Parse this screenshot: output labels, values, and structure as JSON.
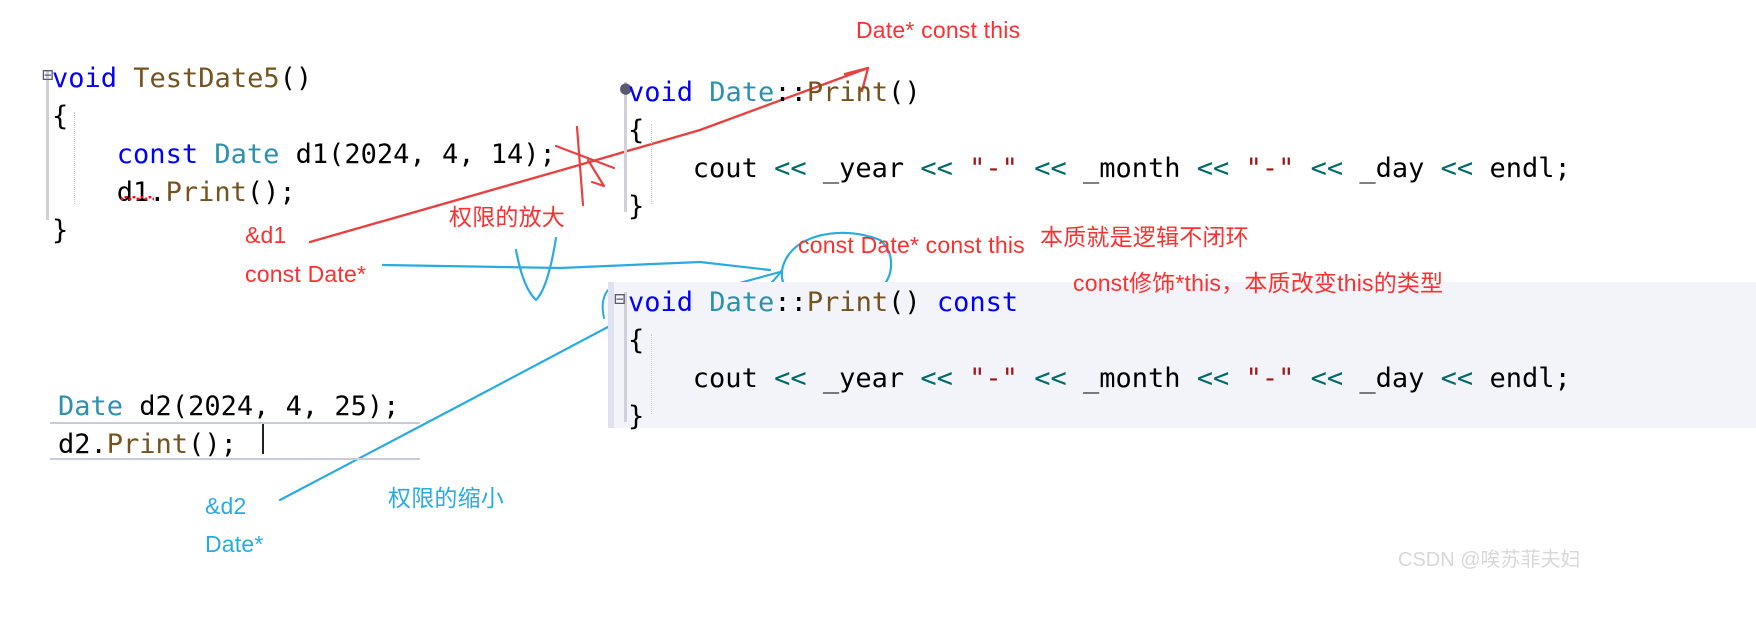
{
  "editor": {
    "upper_left_block": {
      "name": "TestDate5 function",
      "lines": [
        {
          "indent": 0,
          "tokens": [
            {
              "t": "void ",
              "c": "kw"
            },
            {
              "t": "TestDate5",
              "c": "fn"
            },
            {
              "t": "()",
              "c": "ident"
            }
          ]
        },
        {
          "indent": 0,
          "tokens": [
            {
              "t": "{",
              "c": "ident"
            }
          ]
        },
        {
          "indent": 1,
          "tokens": [
            {
              "t": "const ",
              "c": "kw"
            },
            {
              "t": "Date",
              "c": "type"
            },
            {
              "t": " d1(",
              "c": "ident"
            },
            {
              "t": "2024",
              "c": "num"
            },
            {
              "t": ", ",
              "c": "ident"
            },
            {
              "t": "4",
              "c": "num"
            },
            {
              "t": ", ",
              "c": "ident"
            },
            {
              "t": "14",
              "c": "num"
            },
            {
              "t": ");",
              "c": "ident"
            }
          ]
        },
        {
          "indent": 1,
          "tokens": [
            {
              "t": "d1.",
              "c": "ident"
            },
            {
              "t": "Print",
              "c": "fn"
            },
            {
              "t": "();",
              "c": "ident"
            }
          ]
        },
        {
          "indent": 0,
          "tokens": [
            {
              "t": "}",
              "c": "ident"
            }
          ]
        }
      ]
    },
    "upper_right_block": {
      "name": "Date::Print non-const",
      "lines": [
        {
          "indent": 0,
          "tokens": [
            {
              "t": "void ",
              "c": "kw"
            },
            {
              "t": "Date",
              "c": "type"
            },
            {
              "t": "::",
              "c": "ident"
            },
            {
              "t": "Print",
              "c": "fn"
            },
            {
              "t": "()",
              "c": "ident"
            }
          ]
        },
        {
          "indent": 0,
          "tokens": [
            {
              "t": "{",
              "c": "ident"
            }
          ]
        },
        {
          "indent": 1,
          "tokens": [
            {
              "t": "cout ",
              "c": "ident"
            },
            {
              "t": "<<",
              "c": "op"
            },
            {
              "t": " _year ",
              "c": "ident"
            },
            {
              "t": "<<",
              "c": "op"
            },
            {
              "t": " ",
              "c": "ident"
            },
            {
              "t": "\"-\"",
              "c": "str"
            },
            {
              "t": " ",
              "c": "ident"
            },
            {
              "t": "<<",
              "c": "op"
            },
            {
              "t": " _month ",
              "c": "ident"
            },
            {
              "t": "<<",
              "c": "op"
            },
            {
              "t": " ",
              "c": "ident"
            },
            {
              "t": "\"-\"",
              "c": "str"
            },
            {
              "t": " ",
              "c": "ident"
            },
            {
              "t": "<<",
              "c": "op"
            },
            {
              "t": " _day ",
              "c": "ident"
            },
            {
              "t": "<<",
              "c": "op"
            },
            {
              "t": " endl;",
              "c": "ident"
            }
          ]
        },
        {
          "indent": 0,
          "tokens": [
            {
              "t": "}",
              "c": "ident"
            }
          ]
        }
      ]
    },
    "lower_right_block": {
      "name": "Date::Print const",
      "lines": [
        {
          "indent": 0,
          "tokens": [
            {
              "t": "void ",
              "c": "kw"
            },
            {
              "t": "Date",
              "c": "type"
            },
            {
              "t": "::",
              "c": "ident"
            },
            {
              "t": "Print",
              "c": "fn"
            },
            {
              "t": "() ",
              "c": "ident"
            },
            {
              "t": "const",
              "c": "kw"
            }
          ]
        },
        {
          "indent": 0,
          "tokens": [
            {
              "t": "{",
              "c": "ident"
            }
          ]
        },
        {
          "indent": 1,
          "tokens": [
            {
              "t": "cout ",
              "c": "ident"
            },
            {
              "t": "<<",
              "c": "op"
            },
            {
              "t": " _year ",
              "c": "ident"
            },
            {
              "t": "<<",
              "c": "op"
            },
            {
              "t": " ",
              "c": "ident"
            },
            {
              "t": "\"-\"",
              "c": "str"
            },
            {
              "t": " ",
              "c": "ident"
            },
            {
              "t": "<<",
              "c": "op"
            },
            {
              "t": " _month ",
              "c": "ident"
            },
            {
              "t": "<<",
              "c": "op"
            },
            {
              "t": " ",
              "c": "ident"
            },
            {
              "t": "\"-\"",
              "c": "str"
            },
            {
              "t": " ",
              "c": "ident"
            },
            {
              "t": "<<",
              "c": "op"
            },
            {
              "t": " _day ",
              "c": "ident"
            },
            {
              "t": "<<",
              "c": "op"
            },
            {
              "t": " endl;",
              "c": "ident"
            }
          ]
        },
        {
          "indent": 0,
          "tokens": [
            {
              "t": "}",
              "c": "ident"
            }
          ]
        }
      ]
    },
    "bottom_left_block": {
      "name": "d2 snippet",
      "lines": [
        {
          "indent": 0,
          "tokens": [
            {
              "t": "Date",
              "c": "type"
            },
            {
              "t": " d2(",
              "c": "ident"
            },
            {
              "t": "2024",
              "c": "num"
            },
            {
              "t": ", ",
              "c": "ident"
            },
            {
              "t": "4",
              "c": "num"
            },
            {
              "t": ", ",
              "c": "ident"
            },
            {
              "t": "25",
              "c": "num"
            },
            {
              "t": ");",
              "c": "ident"
            }
          ]
        },
        {
          "indent": 0,
          "tokens": [
            {
              "t": "d2.",
              "c": "ident"
            },
            {
              "t": "Print",
              "c": "fn"
            },
            {
              "t": "();",
              "c": "ident"
            }
          ]
        }
      ]
    },
    "collapse_glyph": "⊟"
  },
  "annotations": {
    "date_const_this": "Date* const this",
    "quanxian_fangda": "权限的放大",
    "amp_d1": "&d1",
    "const_date_ptr": "const Date*",
    "const_date_const_this": "const Date* const this",
    "benzhi_luoji": "本质就是逻辑不闭环",
    "const_xiushi_this": "const修饰*this，本质改变this的类型",
    "amp_d2": "&d2",
    "quanxian_suoxiao": "权限的缩小",
    "date_ptr": "Date*"
  },
  "watermark": "CSDN @唉苏菲夫妇",
  "colors": {
    "annotation_red": "#fc3030",
    "annotation_blue": "#29abe2",
    "keyword": "#0000ff",
    "type": "#2b91af",
    "function": "#74531f",
    "string": "#a31515",
    "operator": "#006a6a",
    "panel_background": "#f3f4f9",
    "watermark": "#d8d8d8"
  }
}
